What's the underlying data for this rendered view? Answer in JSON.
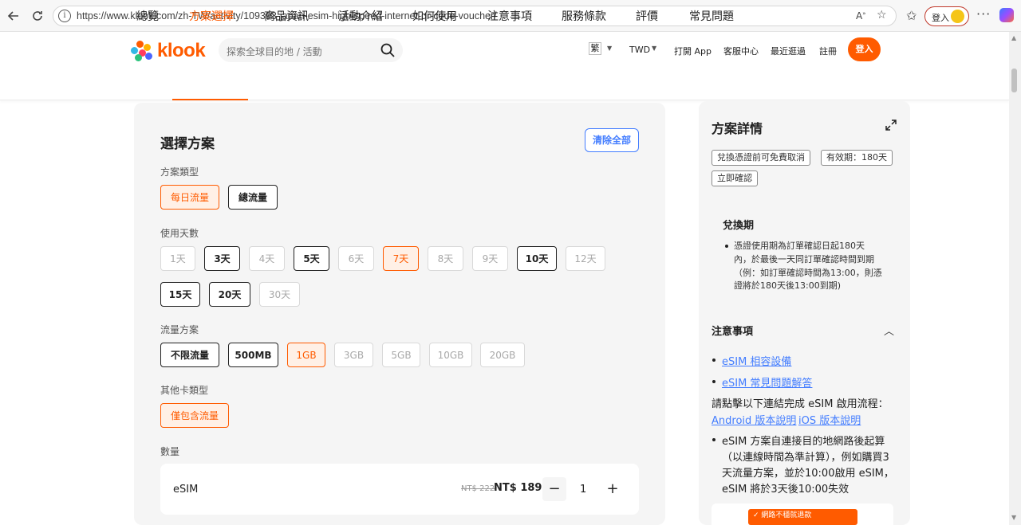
{
  "browser": {
    "url": "https://www.klook.com/zh-TW/activity/109393-japan-esim-high-speed-internet-qr-code-voucher/",
    "login_label": "登入"
  },
  "header": {
    "brand": "klook",
    "search_placeholder": "探索全球目的地 / 活動",
    "lang": "繁",
    "currency": "TWD",
    "open_app": "打開 App",
    "support": "客服中心",
    "recent": "最近逛過",
    "signup": "註冊",
    "login": "登入"
  },
  "tabs": [
    "總覽",
    "方案選擇",
    "商品資訊",
    "活動介紹",
    "如何使用",
    "注意事項",
    "服務條款",
    "評價",
    "常見問題"
  ],
  "active_tab": "方案選擇",
  "plan": {
    "title": "選擇方案",
    "clear_all": "清除全部",
    "type_label": "方案類型",
    "types": [
      {
        "label": "每日流量",
        "state": "active"
      },
      {
        "label": "總流量",
        "state": "enabled"
      }
    ],
    "days_label": "使用天數",
    "days_row1": [
      {
        "label": "1天",
        "state": "disabled"
      },
      {
        "label": "3天",
        "state": "enabled"
      },
      {
        "label": "4天",
        "state": "disabled"
      },
      {
        "label": "5天",
        "state": "enabled"
      },
      {
        "label": "6天",
        "state": "disabled"
      },
      {
        "label": "7天",
        "state": "active"
      },
      {
        "label": "8天",
        "state": "disabled"
      },
      {
        "label": "9天",
        "state": "disabled"
      },
      {
        "label": "10天",
        "state": "enabled"
      },
      {
        "label": "12天",
        "state": "disabled"
      }
    ],
    "days_row2": [
      {
        "label": "15天",
        "state": "enabled"
      },
      {
        "label": "20天",
        "state": "enabled"
      },
      {
        "label": "30天",
        "state": "disabled"
      }
    ],
    "data_label": "流量方案",
    "data_options": [
      {
        "label": "不限流量",
        "state": "enabled"
      },
      {
        "label": "500MB",
        "state": "enabled"
      },
      {
        "label": "1GB",
        "state": "active"
      },
      {
        "label": "3GB",
        "state": "disabled"
      },
      {
        "label": "5GB",
        "state": "disabled"
      },
      {
        "label": "10GB",
        "state": "disabled"
      },
      {
        "label": "20GB",
        "state": "disabled"
      }
    ],
    "card_label": "其他卡類型",
    "card_options": [
      {
        "label": "僅包含流量",
        "state": "active"
      }
    ],
    "qty_label": "數量",
    "qty_item": "eSIM",
    "old_price": "NT$ 222",
    "new_price": "NT$ 189",
    "qty_value": "1",
    "minus": "−",
    "plus": "+"
  },
  "details": {
    "title": "方案詳情",
    "tags": [
      "兌換憑證前可免費取消",
      "有效期：180天",
      "立即確認"
    ],
    "redeem_title": "兌換期",
    "redeem_lines": [
      "憑證使用期為訂單確認日起180天",
      "內，於最後一天同訂單確認時間到期",
      "（例：如訂單確認時間為13:00，則憑",
      "證將於180天後13:00到期)"
    ],
    "notes_title": "注意事項",
    "link1": "eSIM 相容設備",
    "link2": "eSIM 常見問題解答",
    "intro_text": "請點擊以下連結完成 eSIM 啟用流程：",
    "android_link": "Android 版本說明",
    "ios_link": "iOS 版本說明",
    "note_lines": [
      "eSIM 方案自連接目的地網路後起算",
      "（以連線時間為準計算），例如購買3",
      "天流量方案，並於10:00啟用 eSIM，",
      "eSIM 將於3天後10:00失效"
    ],
    "banner": "網路不穩就退款"
  },
  "colors": {
    "accent": "#ff5b00",
    "link": "#437dff"
  }
}
